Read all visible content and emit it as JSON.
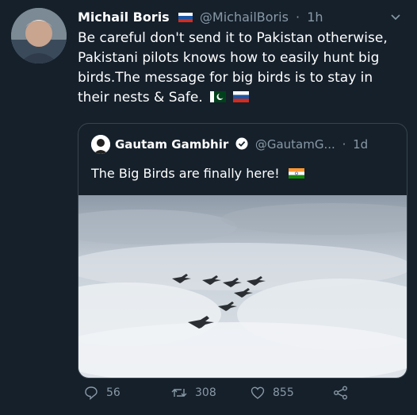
{
  "author": {
    "name": "Michail Boris",
    "handle": "@MichailBoris",
    "time": "1h"
  },
  "tweet_text": "Be careful don't send it to Pakistan otherwise, Pakistani pilots knows how to easily hunt big birds.The message for big birds is to stay in their nests & Safe.",
  "quoted": {
    "name": "Gautam Gambhir",
    "handle": "@GautamG...",
    "time": "1d",
    "text": "The Big Birds are finally here!"
  },
  "stats": {
    "replies": "56",
    "retweets": "308",
    "likes": "855"
  },
  "icons": [
    "flag-russia-icon",
    "chevron-down-icon",
    "verified-icon",
    "flag-india-icon",
    "flag-pakistan-icon",
    "reply-icon",
    "retweet-icon",
    "like-icon",
    "share-icon"
  ],
  "colors": {
    "background": "#15202b",
    "secondary_text": "#8899a6",
    "border": "#38444d",
    "verified": "#ffffff"
  }
}
